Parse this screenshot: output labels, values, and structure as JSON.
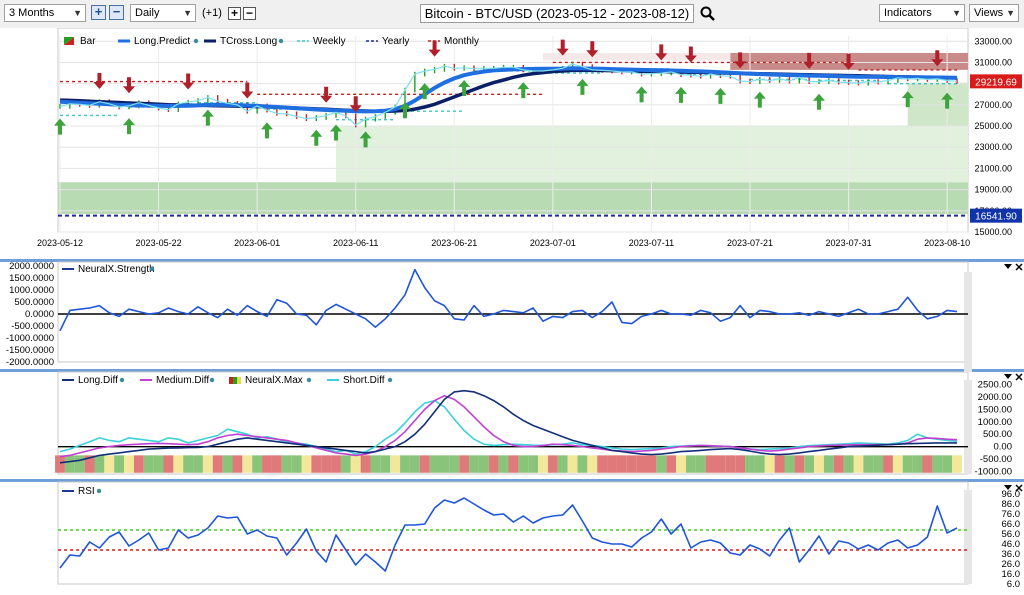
{
  "toolbar": {
    "period": "3 Months",
    "interval": "Daily",
    "offset": "(+1)",
    "title": "Bitcoin - BTC/USD (2023-05-12 - 2023-08-12)",
    "indicators_label": "Indicators",
    "views_label": "Views",
    "plus": "+",
    "minus": "−",
    "arrow": "▼"
  },
  "price_panel": {
    "legend": [
      "Bar",
      "Long.Predict",
      "TCross.Long",
      "Weekly",
      "Yearly",
      "Monthly"
    ],
    "price_label": "29219.69",
    "yearly_label": "16541.90",
    "y_ticks": [
      "33000.00",
      "31000.00",
      "29000.00",
      "27000.00",
      "25000.00",
      "23000.00",
      "21000.00",
      "19000.00",
      "17000.00",
      "15000.00"
    ],
    "x_ticks": [
      "2023-05-12",
      "2023-05-22",
      "2023-06-01",
      "2023-06-11",
      "2023-06-21",
      "2023-07-01",
      "2023-07-11",
      "2023-07-21",
      "2023-07-31",
      "2023-08-10"
    ]
  },
  "neural_panel": {
    "legend": "NeuralX.Strength",
    "y_ticks": [
      "2000.0000",
      "1500.0000",
      "1000.0000",
      "500.0000",
      "0.0000",
      "-500.0000",
      "-1000.0000",
      "-1500.0000",
      "-2000.0000"
    ]
  },
  "diff_panel": {
    "legend": [
      "Long.Diff",
      "Medium.Diff",
      "NeuralX.Max",
      "Short.Diff"
    ],
    "y_ticks": [
      "2500.00",
      "2000.00",
      "1500.00",
      "1000.00",
      "500.00",
      "0.00",
      "-500.00",
      "-1000.00"
    ]
  },
  "rsi_panel": {
    "legend": "RSI",
    "y_ticks": [
      "96.0",
      "86.0",
      "76.0",
      "66.0",
      "56.0",
      "46.0",
      "36.0",
      "26.0",
      "16.0",
      "6.0"
    ]
  },
  "chart_data": {
    "type": "line",
    "title": "Bitcoin - BTC/USD (2023-05-12 - 2023-08-12)",
    "x_start": "2023-05-12",
    "x_end": "2023-08-12",
    "price": {
      "ylim": [
        15000,
        33500
      ],
      "close": [
        26850,
        27100,
        27050,
        26950,
        27300,
        27100,
        26800,
        26900,
        27200,
        26950,
        26700,
        26550,
        27100,
        27250,
        27400,
        27700,
        27350,
        27150,
        27000,
        26400,
        26900,
        26500,
        26200,
        26150,
        25900,
        25700,
        25800,
        26000,
        26300,
        25950,
        25100,
        25650,
        25900,
        26300,
        26800,
        28400,
        29900,
        30200,
        30350,
        30650,
        30450,
        30500,
        30400,
        30450,
        30450,
        30550,
        30550,
        30300,
        30200,
        30200,
        30300,
        30450,
        30850,
        30600,
        30300,
        30250,
        30200,
        30100,
        30100,
        29900,
        29950,
        30000,
        30100,
        29850,
        29800,
        29700,
        29900,
        29750,
        29700,
        29250,
        29200,
        29400,
        29300,
        29450,
        29250,
        29600,
        29200,
        29200,
        29300,
        29150,
        29100,
        29050,
        29200,
        29150,
        29300,
        29550,
        29450,
        29500,
        29400,
        29450,
        29300,
        29220
      ],
      "long_predict": [
        27300,
        27250,
        27200,
        27150,
        27100,
        27050,
        27000,
        26970,
        26950,
        26930,
        26910,
        26890,
        26900,
        26920,
        26950,
        27000,
        27020,
        27000,
        26980,
        26940,
        26900,
        26850,
        26800,
        26740,
        26680,
        26620,
        26560,
        26520,
        26480,
        26440,
        26400,
        26380,
        26400,
        26450,
        26600,
        26900,
        27400,
        28000,
        28600,
        29100,
        29500,
        29800,
        30000,
        30150,
        30250,
        30300,
        30350,
        30380,
        30390,
        30400,
        30410,
        30420,
        30450,
        30440,
        30420,
        30400,
        30380,
        30350,
        30330,
        30300,
        30280,
        30260,
        30240,
        30220,
        30190,
        30160,
        30120,
        30080,
        30040,
        29990,
        29940,
        29900,
        29870,
        29840,
        29810,
        29790,
        29760,
        29740,
        29720,
        29700,
        29680,
        29660,
        29650,
        29640,
        29630,
        29620,
        29610,
        29600,
        29590,
        29580,
        29570,
        29560
      ],
      "tcross_long": [
        27450,
        27420,
        27380,
        27340,
        27300,
        27260,
        27220,
        27180,
        27140,
        27100,
        27060,
        27020,
        27000,
        26980,
        26960,
        26940,
        26920,
        26900,
        26880,
        26860,
        26840,
        26820,
        26780,
        26740,
        26700,
        26660,
        26620,
        26580,
        26540,
        26500,
        26460,
        26420,
        26400,
        26400,
        26420,
        26480,
        26600,
        26800,
        27050,
        27400,
        27750,
        28100,
        28450,
        28800,
        29100,
        29350,
        29600,
        29800,
        29950,
        30050,
        30150,
        30200,
        30250,
        30250,
        30250,
        30240,
        30230,
        30220,
        30200,
        30180,
        30160,
        30140,
        30120,
        30100,
        30080,
        30060,
        30040,
        30020,
        30000,
        29980,
        29960,
        29940,
        29920,
        29900,
        29880,
        29860,
        29840,
        29820,
        29800,
        29780,
        29760,
        29740,
        29720,
        29700,
        29680,
        29660,
        29640,
        29620,
        29600,
        29580,
        29560,
        29540
      ],
      "weekly_segments": [
        [
          0,
          6,
          26000
        ],
        [
          7,
          13,
          26800
        ],
        [
          14,
          20,
          27200
        ],
        [
          21,
          27,
          26600
        ],
        [
          28,
          34,
          25600
        ],
        [
          35,
          41,
          26400
        ],
        [
          42,
          48,
          30200
        ],
        [
          49,
          55,
          30000
        ],
        [
          56,
          62,
          30400
        ],
        [
          63,
          69,
          29900
        ],
        [
          70,
          76,
          29400
        ],
        [
          77,
          83,
          29300
        ],
        [
          84,
          91,
          29000
        ]
      ],
      "monthly_segments": [
        [
          0,
          19,
          29200
        ],
        [
          20,
          49,
          28000
        ],
        [
          50,
          80,
          31000
        ],
        [
          81,
          91,
          30300
        ]
      ],
      "yearly": 16541.9,
      "up_arrows": [
        0,
        7,
        15,
        21,
        26,
        28,
        31,
        35,
        37,
        41,
        47,
        53,
        59,
        63,
        67,
        71,
        77,
        86,
        90
      ],
      "down_arrows": [
        4,
        7,
        13,
        19,
        27,
        30,
        38,
        51,
        54,
        61,
        64,
        69,
        76,
        80,
        89
      ]
    },
    "neuralx_strength": {
      "ylim": [
        -2000,
        2000
      ],
      "values": [
        -700,
        150,
        200,
        250,
        350,
        50,
        -100,
        200,
        100,
        0,
        50,
        250,
        100,
        0,
        300,
        50,
        -150,
        200,
        -50,
        350,
        100,
        -100,
        600,
        450,
        0,
        -50,
        -450,
        150,
        400,
        200,
        0,
        -200,
        -550,
        -200,
        250,
        800,
        1850,
        1100,
        550,
        350,
        -200,
        -250,
        350,
        -100,
        0,
        150,
        100,
        50,
        250,
        -300,
        -100,
        -150,
        100,
        150,
        -150,
        100,
        500,
        -350,
        -400,
        -100,
        0,
        150,
        0,
        0,
        -50,
        150,
        50,
        -300,
        -150,
        350,
        -150,
        150,
        100,
        0,
        0,
        50,
        -50,
        100,
        0,
        -100,
        50,
        200,
        0,
        0,
        100,
        200,
        700,
        150,
        -200,
        -100,
        150,
        100
      ]
    },
    "diff": {
      "ylim": [
        -1100,
        2600
      ],
      "long_diff": [
        -650,
        -600,
        -550,
        -450,
        -350,
        -300,
        -250,
        -200,
        -150,
        -100,
        -80,
        -60,
        -50,
        -40,
        -30,
        0,
        100,
        200,
        300,
        350,
        300,
        250,
        200,
        150,
        100,
        50,
        0,
        -50,
        -100,
        -150,
        -200,
        -250,
        -200,
        -100,
        0,
        200,
        500,
        900,
        1400,
        1900,
        2200,
        2250,
        2200,
        2050,
        1850,
        1600,
        1300,
        1050,
        850,
        700,
        550,
        400,
        250,
        150,
        50,
        -50,
        -150,
        -200,
        -250,
        -300,
        -320,
        -300,
        -250,
        -200,
        -180,
        -150,
        -120,
        -100,
        -80,
        -120,
        -180,
        -250,
        -300,
        -320,
        -300,
        -250,
        -200,
        -150,
        -100,
        -50,
        0,
        20,
        40,
        60,
        80,
        100,
        120,
        130,
        140,
        150,
        150,
        150
      ],
      "medium_diff": [
        -400,
        -350,
        -250,
        -150,
        -50,
        0,
        50,
        80,
        100,
        120,
        130,
        120,
        100,
        80,
        100,
        200,
        350,
        450,
        500,
        450,
        400,
        350,
        300,
        250,
        150,
        50,
        -50,
        -150,
        -250,
        -300,
        -350,
        -300,
        -200,
        0,
        250,
        600,
        1050,
        1500,
        1850,
        2050,
        1900,
        1600,
        1200,
        800,
        450,
        200,
        50,
        0,
        0,
        50,
        100,
        80,
        50,
        0,
        -50,
        -100,
        -150,
        -180,
        -200,
        -180,
        -150,
        -100,
        -50,
        0,
        30,
        50,
        40,
        20,
        0,
        -50,
        -100,
        -150,
        -180,
        -150,
        -100,
        -50,
        0,
        30,
        50,
        60,
        70,
        80,
        80,
        80,
        80,
        100,
        150,
        300,
        350,
        330,
        300,
        280
      ],
      "short_diff": [
        -200,
        -100,
        50,
        200,
        350,
        250,
        200,
        350,
        300,
        250,
        200,
        350,
        300,
        150,
        250,
        350,
        450,
        700,
        600,
        500,
        350,
        400,
        300,
        200,
        150,
        100,
        0,
        -100,
        -200,
        -150,
        -300,
        -200,
        0,
        300,
        550,
        950,
        1400,
        1750,
        1850,
        1600,
        1100,
        650,
        300,
        100,
        50,
        80,
        100,
        80,
        60,
        50,
        80,
        100,
        150,
        80,
        50,
        0,
        -50,
        -100,
        -120,
        -100,
        -80,
        -50,
        0,
        20,
        40,
        50,
        30,
        20,
        0,
        -50,
        -100,
        -120,
        -100,
        -80,
        -50,
        0,
        40,
        60,
        80,
        100,
        120,
        150,
        130,
        120,
        100,
        150,
        250,
        500,
        350,
        300,
        250,
        220
      ],
      "neuralx_max_colors": [
        "r",
        "g",
        "g",
        "r",
        "g",
        "y",
        "g",
        "y",
        "r",
        "g",
        "g",
        "r",
        "y",
        "g",
        "g",
        "y",
        "r",
        "g",
        "r",
        "y",
        "g",
        "r",
        "r",
        "g",
        "g",
        "y",
        "r",
        "r",
        "r",
        "g",
        "y",
        "r",
        "g",
        "g",
        "y",
        "g",
        "g",
        "r",
        "g",
        "g",
        "g",
        "r",
        "g",
        "g",
        "r",
        "g",
        "r",
        "g",
        "g",
        "y",
        "r",
        "g",
        "y",
        "g",
        "y",
        "r",
        "r",
        "r",
        "r",
        "r",
        "r",
        "g",
        "r",
        "y",
        "g",
        "g",
        "r",
        "r",
        "r",
        "r",
        "g",
        "g",
        "y",
        "r",
        "g",
        "r",
        "g",
        "y",
        "g",
        "r",
        "g",
        "y",
        "g",
        "g",
        "r",
        "y",
        "g",
        "g",
        "r",
        "g",
        "g",
        "y"
      ]
    },
    "rsi": {
      "ylim": [
        6,
        98
      ],
      "overbought": 60,
      "oversold": 40,
      "values": [
        22,
        35,
        34,
        48,
        42,
        53,
        58,
        44,
        50,
        57,
        40,
        42,
        60,
        52,
        55,
        62,
        74,
        72,
        73,
        56,
        60,
        54,
        52,
        35,
        47,
        61,
        39,
        28,
        55,
        40,
        25,
        36,
        28,
        19,
        45,
        65,
        65,
        66,
        82,
        90,
        87,
        92,
        86,
        80,
        75,
        76,
        68,
        74,
        67,
        72,
        74,
        75,
        85,
        69,
        52,
        48,
        46,
        46,
        43,
        52,
        58,
        71,
        56,
        66,
        42,
        48,
        50,
        47,
        37,
        35,
        45,
        41,
        34,
        50,
        62,
        28,
        40,
        54,
        36,
        49,
        47,
        41,
        45,
        40,
        47,
        50,
        42,
        45,
        53,
        84,
        57,
        62
      ]
    }
  }
}
